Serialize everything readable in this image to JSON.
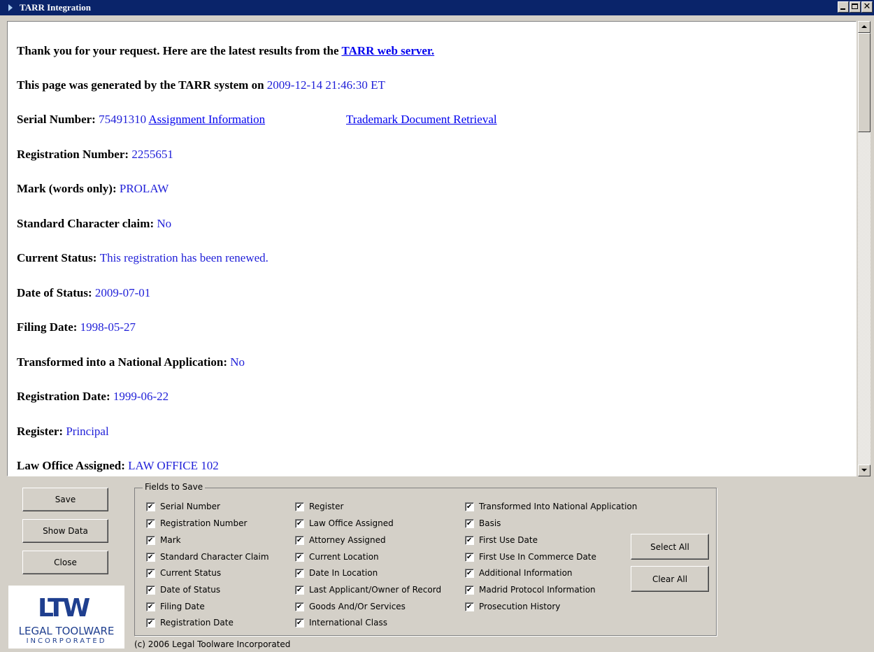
{
  "window": {
    "title": "TARR Integration"
  },
  "content": {
    "intro_text": "Thank you for your request. Here are the latest results from the ",
    "intro_link": "TARR web server.",
    "generated_text": "This page was generated by the TARR system on ",
    "generated_value": "2009-12-14 21:46:30 ET",
    "serial_label": "Serial Number: ",
    "serial_value": "75491310",
    "assignment_link": "Assignment Information",
    "document_link": "Trademark Document Retrieval",
    "fields": [
      {
        "label": "Registration Number: ",
        "value": "2255651"
      },
      {
        "label": "Mark (words only): ",
        "value": "PROLAW"
      },
      {
        "label": "Standard Character claim: ",
        "value": "No"
      },
      {
        "label": "Current Status: ",
        "value": "This registration has been renewed."
      },
      {
        "label": "Date of Status: ",
        "value": "2009-07-01"
      },
      {
        "label": "Filing Date: ",
        "value": "1998-05-27"
      },
      {
        "label": "Transformed into a National Application: ",
        "value": "No"
      },
      {
        "label": "Registration Date: ",
        "value": "1999-06-22"
      },
      {
        "label": "Register: ",
        "value": "Principal"
      },
      {
        "label": "Law Office Assigned: ",
        "value": "LAW OFFICE 102"
      }
    ]
  },
  "buttons": {
    "save": "Save",
    "show_data": "Show Data",
    "close": "Close",
    "select_all": "Select All",
    "clear_all": "Clear All"
  },
  "fields_group": {
    "legend": "Fields to Save",
    "col1": [
      "Serial Number",
      "Registration Number",
      "Mark",
      "Standard Character Claim",
      "Current Status",
      "Date of Status",
      "Filing Date",
      "Registration Date"
    ],
    "col2": [
      "Register",
      "Law Office Assigned",
      "Attorney Assigned",
      "Current Location",
      "Date In Location",
      "Last Applicant/Owner of Record",
      "Goods And/Or Services",
      "International Class"
    ],
    "col3": [
      "Transformed Into National Application",
      "Basis",
      "First Use Date",
      "First Use In Commerce Date",
      "Additional Information",
      "Madrid Protocol Information",
      "Prosecution History"
    ]
  },
  "logo": {
    "mark": "LTW",
    "line1": "LEGAL TOOLWARE",
    "line2": "INCORPORATED"
  },
  "footer": {
    "copyright": "(c) 2006 Legal Toolware Incorporated"
  },
  "colors": {
    "titlebar": "#0a246a",
    "value_text": "#1f1fd8",
    "link": "#0000ee",
    "face": "#d4d0c8"
  }
}
